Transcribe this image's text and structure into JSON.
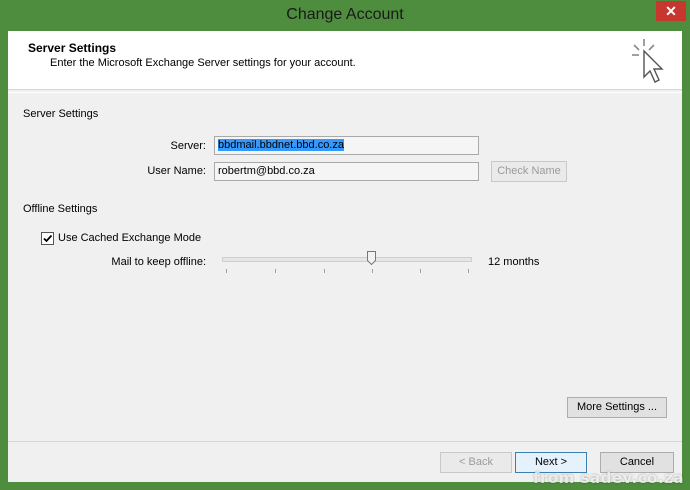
{
  "window": {
    "title": "Change Account",
    "close_glyph": "✕"
  },
  "header": {
    "title": "Server Settings",
    "subtitle": "Enter the Microsoft Exchange Server settings for your account."
  },
  "server_section": {
    "heading": "Server Settings",
    "server_label": "Server:",
    "server_value": "bbdmail.bbdnet.bbd.co.za",
    "username_label": "User Name:",
    "username_value": "robertm@bbd.co.za",
    "check_name_label": "Check Name"
  },
  "offline_section": {
    "heading": "Offline Settings",
    "cached_mode_label": "Use Cached Exchange Mode",
    "cached_mode_checked": true,
    "mail_keep_label": "Mail to keep offline:",
    "mail_keep_value": "12 months"
  },
  "buttons": {
    "more_settings": "More Settings ...",
    "back": "< Back",
    "next": "Next >",
    "cancel": "Cancel"
  },
  "watermark": "from sadev.co.za",
  "colors": {
    "title_green": "#4e8c3e",
    "close_red": "#c7372f",
    "selection_blue": "#3399ff"
  }
}
